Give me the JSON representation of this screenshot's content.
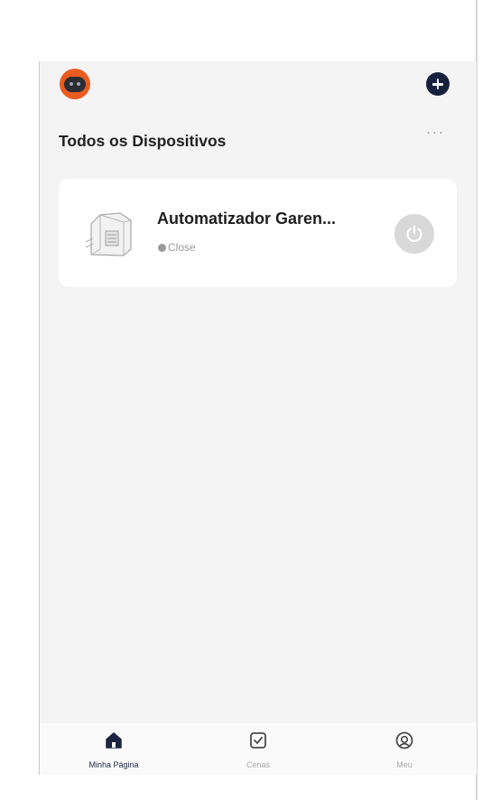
{
  "header": {
    "avatar_icon": "robot-avatar-icon",
    "add_icon": "plus-circle-icon"
  },
  "section": {
    "title": "Todos os Dispositivos",
    "more_label": "···"
  },
  "devices": [
    {
      "name": "Automatizador Garen...",
      "status": "Close",
      "image": "gate-motor-device-icon",
      "power_icon": "power-icon"
    }
  ],
  "tabbar": {
    "tabs": [
      {
        "label": "Minha Página",
        "icon": "home-icon",
        "active": true
      },
      {
        "label": "Cenas",
        "icon": "checkbox-icon",
        "active": false
      },
      {
        "label": "Meu",
        "icon": "user-circle-icon",
        "active": false
      }
    ]
  },
  "colors": {
    "accent": "#16213e",
    "avatar": "#ea5b1f",
    "background": "#f4f4f5",
    "card": "#ffffff",
    "power_off": "#d8d8d8"
  }
}
